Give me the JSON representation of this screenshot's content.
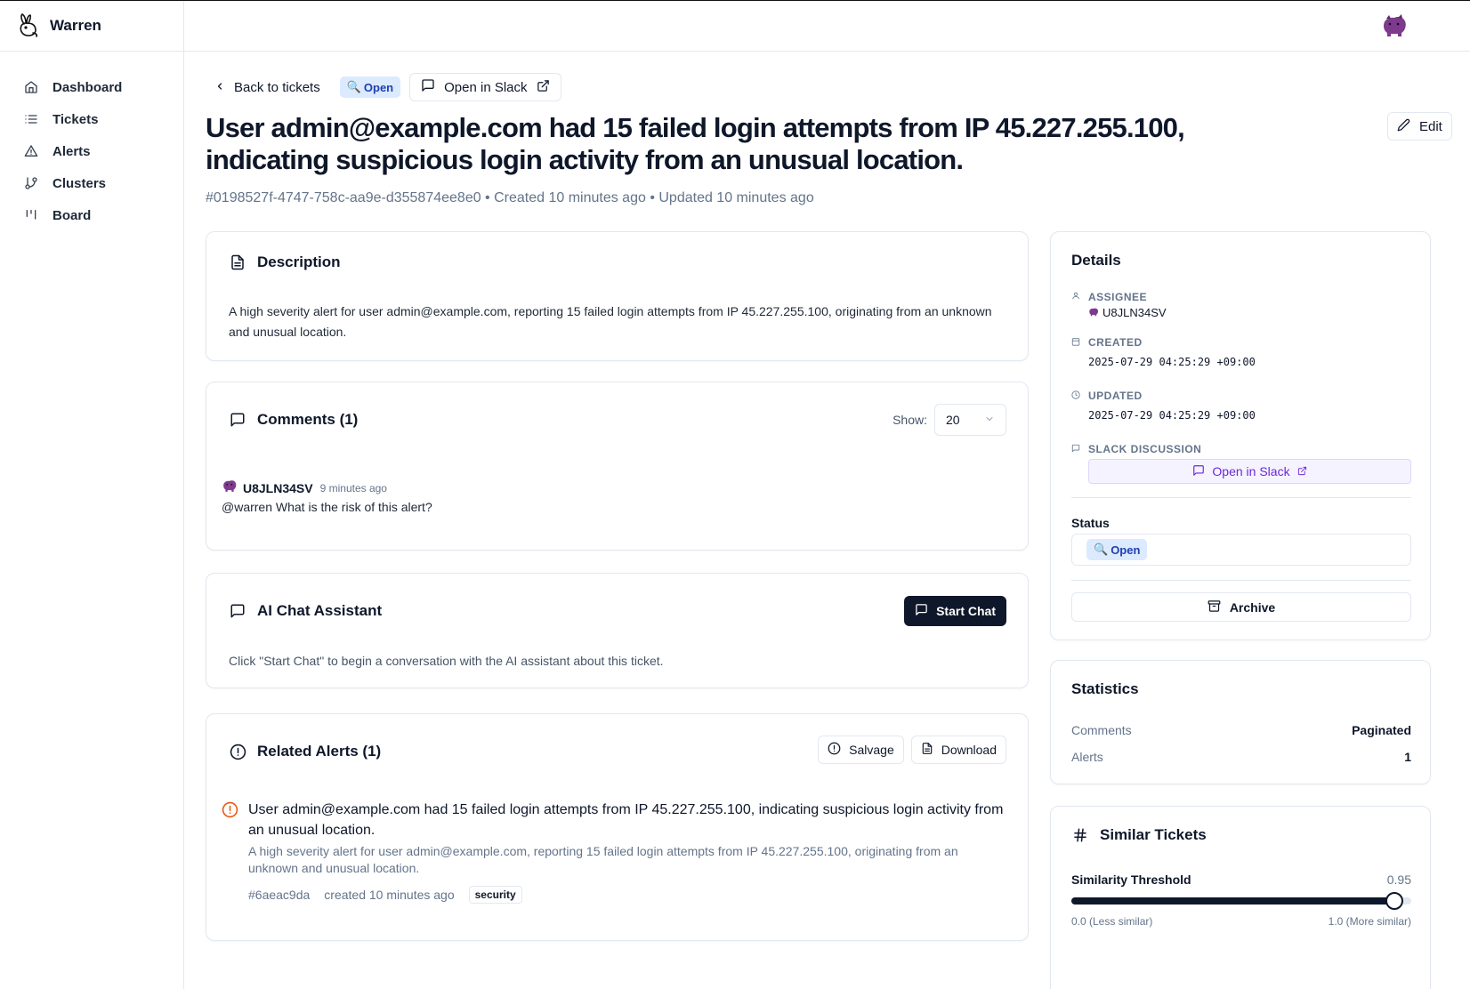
{
  "app": {
    "name": "Warren"
  },
  "sidebar": {
    "items": [
      {
        "label": "Dashboard",
        "icon": "home-icon"
      },
      {
        "label": "Tickets",
        "icon": "list-icon"
      },
      {
        "label": "Alerts",
        "icon": "alert-triangle-icon"
      },
      {
        "label": "Clusters",
        "icon": "git-branch-icon"
      },
      {
        "label": "Board",
        "icon": "kanban-icon"
      }
    ]
  },
  "header": {
    "back_label": "Back to tickets",
    "status_badge": "Open",
    "open_in_slack_label": "Open in Slack",
    "edit_label": "Edit",
    "title": "User admin@example.com had 15 failed login attempts from IP 45.227.255.100, indicating suspicious login activity from an unusual location.",
    "meta": "#0198527f-4747-758c-aa9e-d355874ee8e0 • Created 10 minutes ago • Updated 10 minutes ago"
  },
  "description": {
    "heading": "Description",
    "text": "A high severity alert for user admin@example.com, reporting 15 failed login attempts from IP 45.227.255.100, originating from an unknown and unusual location."
  },
  "comments": {
    "heading": "Comments (1)",
    "show_label": "Show:",
    "show_value": "20",
    "items": [
      {
        "user": "U8JLN34SV",
        "time": "9 minutes ago",
        "text": "@warren What is the risk of this alert?"
      }
    ]
  },
  "ai_chat": {
    "heading": "AI Chat Assistant",
    "button_label": "Start Chat",
    "text": "Click \"Start Chat\" to begin a conversation with the AI assistant about this ticket."
  },
  "related_alerts": {
    "heading": "Related Alerts (1)",
    "salvage_label": "Salvage",
    "download_label": "Download",
    "items": [
      {
        "title": "User admin@example.com had 15 failed login attempts from IP 45.227.255.100, indicating suspicious login activity from an unusual location.",
        "description": "A high severity alert for user admin@example.com, reporting 15 failed login attempts from IP 45.227.255.100, originating from an unknown and unusual location.",
        "id": "#6aeac9da",
        "created": "created 10 minutes ago",
        "tag": "security"
      }
    ]
  },
  "details": {
    "heading": "Details",
    "assignee_label": "Assignee",
    "assignee_value": "U8JLN34SV",
    "created_label": "Created",
    "created_value": "2025-07-29 04:25:29 +09:00",
    "updated_label": "Updated",
    "updated_value": "2025-07-29 04:25:29 +09:00",
    "slack_label": "Slack Discussion",
    "slack_button": "Open in Slack",
    "status_label": "Status",
    "status_value": "Open",
    "archive_label": "Archive"
  },
  "statistics": {
    "heading": "Statistics",
    "rows": [
      {
        "label": "Comments",
        "value": "Paginated"
      },
      {
        "label": "Alerts",
        "value": "1"
      }
    ]
  },
  "similar": {
    "heading": "Similar Tickets",
    "threshold_label": "Similarity Threshold",
    "threshold_value": "0.95",
    "threshold": 0.95,
    "min_label": "0.0 (Less similar)",
    "max_label": "1.0 (More similar)"
  },
  "colors": {
    "accent_dark": "#0f172a",
    "badge_bg": "#dbeafe",
    "slack_purple": "#6d28d9",
    "alert_orange": "#ea580c",
    "avatar_purple": "#7e3a8c"
  }
}
